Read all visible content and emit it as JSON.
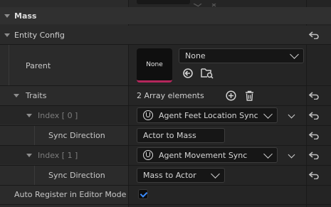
{
  "category": {
    "title": "Mass"
  },
  "entity_config": {
    "title": "Entity Config"
  },
  "parent": {
    "label": "Parent",
    "thumbnail_text": "None",
    "dropdown_value": "None"
  },
  "traits": {
    "label": "Traits",
    "count_text": "2 Array elements",
    "items": [
      {
        "index_label": "Index [ 0 ]",
        "value": "Agent Feet Location Sync",
        "sync_direction_label": "Sync Direction",
        "sync_direction_value": "Actor to Mass"
      },
      {
        "index_label": "Index [ 1 ]",
        "value": "Agent Movement Sync",
        "sync_direction_label": "Sync Direction",
        "sync_direction_value": "Mass to Actor"
      }
    ]
  },
  "auto_register": {
    "label": "Auto Register in Editor Mode",
    "checked": true
  },
  "colors": {
    "accent": "#3b8cff",
    "thumb_underline": "#b4275c"
  },
  "icons": [
    "reset-arrow-icon",
    "use-selected-icon",
    "browse-icon",
    "add-icon",
    "delete-icon",
    "chevron-down-icon",
    "unreal-logo-icon",
    "checkmark-icon"
  ]
}
